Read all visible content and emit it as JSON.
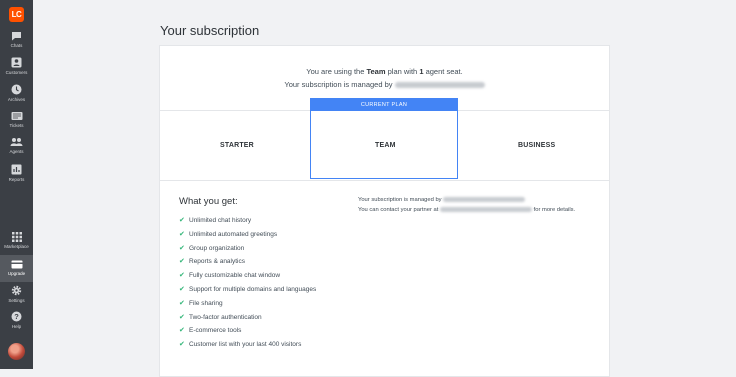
{
  "sidebar": {
    "logo": "LC",
    "items": [
      {
        "label": "Chats",
        "icon": "chat-icon"
      },
      {
        "label": "Customers",
        "icon": "customers-icon"
      },
      {
        "label": "Archives",
        "icon": "archives-icon"
      },
      {
        "label": "Tickets",
        "icon": "tickets-icon"
      },
      {
        "label": "Agents",
        "icon": "agents-icon"
      },
      {
        "label": "Reports",
        "icon": "reports-icon"
      }
    ],
    "bottom_items": [
      {
        "label": "Marketplace",
        "icon": "marketplace-icon"
      },
      {
        "label": "Upgrade",
        "icon": "upgrade-icon",
        "active": true
      },
      {
        "label": "Settings",
        "icon": "settings-icon"
      },
      {
        "label": "Help",
        "icon": "help-icon"
      }
    ]
  },
  "page": {
    "title": "Your subscription"
  },
  "subscription": {
    "line1_prefix": "You are using the",
    "plan": "Team",
    "line1_mid": "plan with",
    "seats": "1",
    "line1_suffix": "agent seat.",
    "line2_prefix": "Your subscription is managed by"
  },
  "plans": {
    "current_label": "CURRENT PLAN",
    "starter": "STARTER",
    "team": "TEAM",
    "business": "BUSINESS"
  },
  "features": {
    "title": "What you get:",
    "items": [
      "Unlimited chat history",
      "Unlimited automated greetings",
      "Group organization",
      "Reports & analytics",
      "Fully customizable chat window",
      "Support for multiple domains and languages",
      "File sharing",
      "Two-factor authentication",
      "E-commerce tools",
      "Customer list with your last 400 visitors"
    ]
  },
  "partner": {
    "line1_prefix": "Your subscription is managed by",
    "line2_prefix": "You can contact your partner at",
    "line2_suffix": "for more details."
  },
  "colors": {
    "sidebar_bg": "#3b3f45",
    "accent": "#4384f5",
    "check": "#34b679",
    "logo": "#ff5100"
  }
}
